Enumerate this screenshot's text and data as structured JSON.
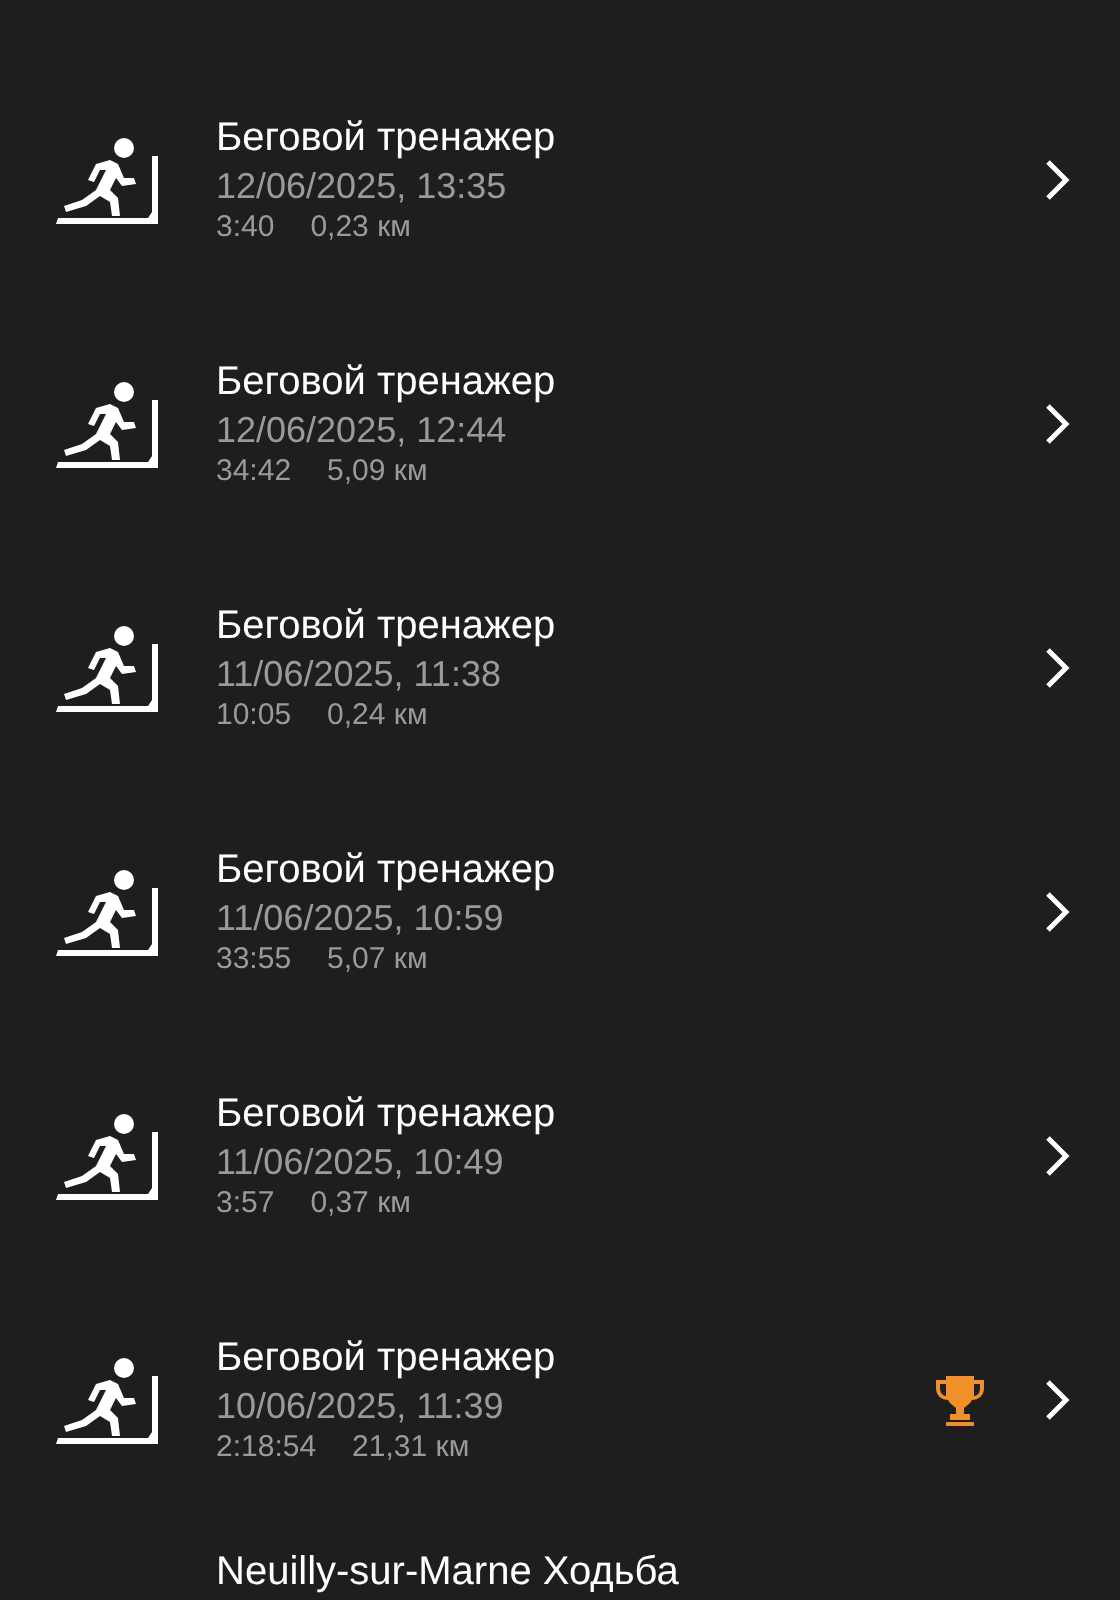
{
  "activities": [
    {
      "title": "Беговой тренажер",
      "datetime": "12/06/2025, 13:35",
      "duration": "3:40",
      "distance": "0,23 км",
      "trophy": false
    },
    {
      "title": "Беговой тренажер",
      "datetime": "12/06/2025, 12:44",
      "duration": "34:42",
      "distance": "5,09 км",
      "trophy": false
    },
    {
      "title": "Беговой тренажер",
      "datetime": "11/06/2025, 11:38",
      "duration": "10:05",
      "distance": "0,24 км",
      "trophy": false
    },
    {
      "title": "Беговой тренажер",
      "datetime": "11/06/2025, 10:59",
      "duration": "33:55",
      "distance": "5,07 км",
      "trophy": false
    },
    {
      "title": "Беговой тренажер",
      "datetime": "11/06/2025, 10:49",
      "duration": "3:57",
      "distance": "0,37 км",
      "trophy": false
    },
    {
      "title": "Беговой тренажер",
      "datetime": "10/06/2025, 11:39",
      "duration": "2:18:54",
      "distance": "21,31 км",
      "trophy": true
    },
    {
      "title": "Neuilly-sur-Marne Ходьба"
    }
  ]
}
